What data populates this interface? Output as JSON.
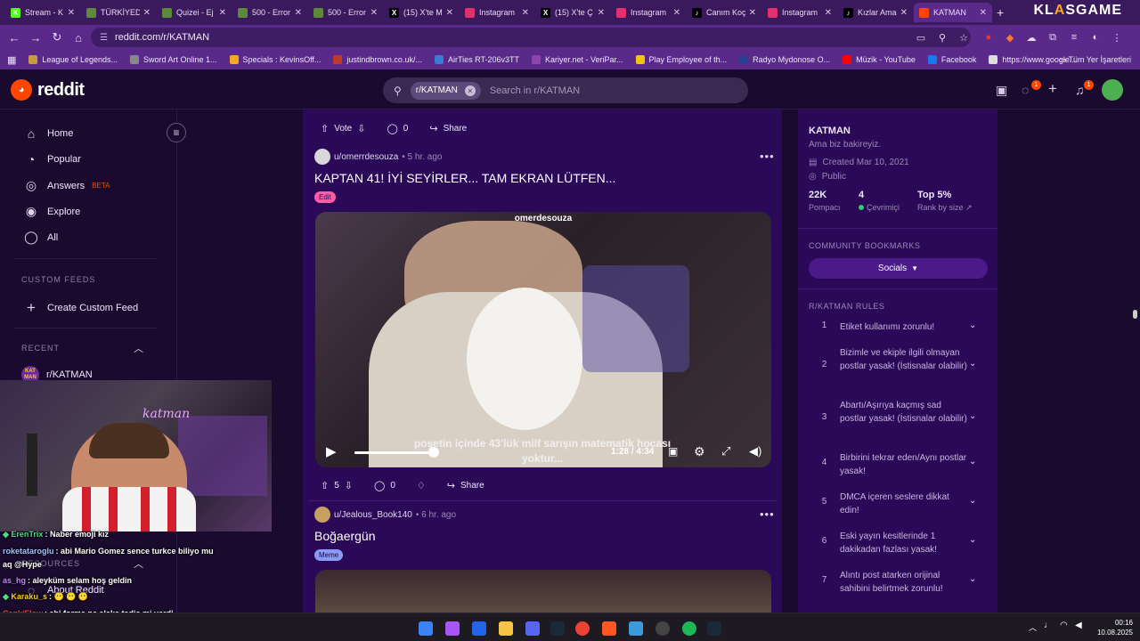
{
  "browser": {
    "tabs": [
      {
        "label": "Stream - K",
        "fav": "K",
        "color": "#53fc18"
      },
      {
        "label": "TÜRKİYEDE",
        "fav": "",
        "color": "#5a8a3a"
      },
      {
        "label": "Quizei - Ej",
        "fav": "",
        "color": "#5a8a3a"
      },
      {
        "label": "500 - Error",
        "fav": "",
        "color": "#5a8a3a"
      },
      {
        "label": "500 - Error",
        "fav": "",
        "color": "#5a8a3a"
      },
      {
        "label": "(15) X'te M",
        "fav": "X",
        "color": "#000000"
      },
      {
        "label": "Instagram",
        "fav": "",
        "color": "#e1306c"
      },
      {
        "label": "(15) X'te Ç",
        "fav": "X",
        "color": "#000000"
      },
      {
        "label": "Instagram",
        "fav": "",
        "color": "#e1306c"
      },
      {
        "label": "Canım Koç",
        "fav": "♪",
        "color": "#000000"
      },
      {
        "label": "Instagram",
        "fav": "",
        "color": "#e1306c"
      },
      {
        "label": "Kızlar Ama",
        "fav": "♪",
        "color": "#000000"
      },
      {
        "label": "KATMAN",
        "fav": "",
        "color": "#ff4500",
        "active": true
      }
    ],
    "url": "reddit.com/r/KATMAN",
    "brand_left": "KL",
    "brand_mid": "A",
    "brand_right": "SGAME",
    "bookmarks": [
      {
        "label": "League of Legends...",
        "color": "#c89b3c"
      },
      {
        "label": "Sword Art Online 1...",
        "color": "#888888"
      },
      {
        "label": "Specials : KevinsOff...",
        "color": "#f5a623"
      },
      {
        "label": "justindbrown.co.uk/...",
        "color": "#c0392b"
      },
      {
        "label": "AirTies RT-206v3TT",
        "color": "#3a7bd5"
      },
      {
        "label": "Kariyer.net - VeriPar...",
        "color": "#8e44ad"
      },
      {
        "label": "Play Employee of th...",
        "color": "#f1c40f"
      },
      {
        "label": "Radyo Mydonose O...",
        "color": "#2c3e90"
      },
      {
        "label": "Müzik - YouTube",
        "color": "#ff0000"
      },
      {
        "label": "Facebook",
        "color": "#1877f2"
      },
      {
        "label": "https://www.google...",
        "color": "#dddddd"
      }
    ],
    "bookmarks_right": "Tüm Yer İşaretleri"
  },
  "reddit": {
    "logo_text": "reddit",
    "search_chip": "r/KATMAN",
    "search_placeholder": "Search in r/KATMAN",
    "chat_badge": "1",
    "notif_badge": "1"
  },
  "sidebar": {
    "items": [
      {
        "label": "Home",
        "icon": "⌂"
      },
      {
        "label": "Popular",
        "icon": "◔"
      },
      {
        "label": "Answers",
        "icon": "◎"
      },
      {
        "label": "Explore",
        "icon": "◉"
      },
      {
        "label": "All",
        "icon": "◯"
      }
    ],
    "answers_badge": "BETA",
    "custom_feeds_heading": "CUSTOM FEEDS",
    "create_feed": "Create Custom Feed",
    "recent_heading": "RECENT",
    "recent_item": "r/KATMAN",
    "recent_icon_text": "KAT MAN",
    "resources_heading": "RESOURCES",
    "about": "About Reddit"
  },
  "feed": {
    "top_actions": {
      "vote": "Vote",
      "comments": "0",
      "share": "Share"
    },
    "post1": {
      "user": "u/omerrdesouza",
      "time": "• 5 hr. ago",
      "title": "KAPTAN 41! İYİ SEYİRLER... TAM EKRAN LÜTFEN...",
      "flair": "Edit",
      "video_watermark": "omerdesouza",
      "video_subtitle": "poşetin içinde 43'lük milf sarışın matematik hocası yoktur...",
      "video_time": "1:28 / 4:34",
      "video_progress": 0.33,
      "votes": "5",
      "comments": "0",
      "share": "Share"
    },
    "post2": {
      "user": "u/Jealous_Book140",
      "time": "• 6 hr. ago",
      "title": "Boğaergün",
      "flair": "Meme"
    }
  },
  "community": {
    "name": "KATMAN",
    "description": "Ama biz bakireyiz.",
    "created": "Created Mar 10, 2021",
    "visibility": "Public",
    "stats": [
      {
        "value": "22K",
        "label": "Pompacı"
      },
      {
        "value": "4",
        "label": "Çevrimiçi"
      },
      {
        "value": "Top 5%",
        "label": "Rank by size"
      }
    ],
    "bookmarks_heading": "COMMUNITY BOOKMARKS",
    "socials": "Socials",
    "rules_heading": "R/KATMAN RULES",
    "rules": [
      {
        "n": "1",
        "text": "Etiket kullanımı zorunlu!"
      },
      {
        "n": "2",
        "text": "Bizimle ve ekiple ilgili olmayan postlar yasak! (İstisnalar olabilir)"
      },
      {
        "n": "3",
        "text": "Abartı/Aşırıya kaçmış sad postlar yasak! (İstisnalar olabilir)"
      },
      {
        "n": "4",
        "text": "Birbirini tekrar eden/Aynı postlar yasak!"
      },
      {
        "n": "5",
        "text": "DMCA içeren seslere dikkat edin!"
      },
      {
        "n": "6",
        "text": "Eski yayın kesitlerinde 1 dakikadan fazlası yasak!"
      },
      {
        "n": "7",
        "text": "Alıntı post atarken orijinal sahibini belirtmek zorunlu!"
      }
    ]
  },
  "stream_overlay": {
    "cam_text": "katman",
    "chat": [
      {
        "user": "ErenTrix",
        "color": "#4ade80",
        "msg": ": Naber emoji kız",
        "badge": true
      },
      {
        "user": "roketataroglu",
        "color": "#9ec5ff",
        "msg": ": abi Mario Gomez sence turkce biliyo mu"
      },
      {
        "user": "",
        "color": "#ffffff",
        "msg": "aq @Hype"
      },
      {
        "user": "as_hg",
        "color": "#c084fc",
        "msg": ": aleyküm selam hoş geldin"
      },
      {
        "user": "Karaku_s",
        "color": "#facc15",
        "msg": ": 😶 😶 😶",
        "badge": true
      },
      {
        "user": "CankiFlow",
        "color": "#ef4444",
        "msg": ": abi forma ne alaka tadic mi verdi"
      }
    ]
  },
  "taskbar": {
    "time": "00:16",
    "date": "10.08.2025"
  }
}
